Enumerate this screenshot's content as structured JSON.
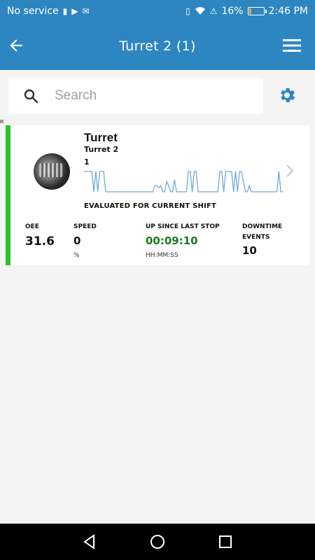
{
  "status_bar": {
    "carrier": "No service",
    "battery_percent": "16%",
    "battery_level": 0.16,
    "time": "2:46 PM",
    "icons": [
      "sim-error-icon",
      "play-store-icon",
      "email-icon",
      "vibrate-icon",
      "wifi-icon",
      "alert-icon",
      "battery-icon"
    ]
  },
  "header": {
    "title": "Turret 2 (1)",
    "icons": {
      "back": "arrow-left-icon",
      "menu": "hamburger-menu-icon"
    }
  },
  "search": {
    "placeholder": "Search",
    "value": "",
    "icons": {
      "search": "search-icon",
      "settings": "gear-icon"
    }
  },
  "machine_card": {
    "title": "Turret",
    "line1": "Turret 2",
    "line2": "1",
    "status_color": "#2fc12f",
    "evaluation_note": "EVALUATED FOR CURRENT SHIFT",
    "metrics": {
      "oee": {
        "label": "OEE",
        "value": "31.6"
      },
      "speed": {
        "label": "SPEED",
        "value": "0",
        "unit": "%"
      },
      "uptime": {
        "label": "UP SINCE LAST STOP",
        "value": "00:09:10",
        "unit": "HH:MM:SS",
        "color": "#1c7a1c"
      },
      "downtime": {
        "label_line1": "DOWNTIME",
        "label_line2": "EVENTS",
        "value": "10"
      }
    }
  },
  "chart_data": {
    "type": "line",
    "series": [
      {
        "values": [
          1,
          1,
          1,
          1,
          1,
          0,
          1,
          0,
          1,
          1,
          1,
          0,
          0,
          0,
          0,
          0,
          0,
          0,
          0,
          0,
          0,
          0,
          0,
          0,
          0,
          0,
          0,
          0,
          0,
          0,
          0,
          0,
          0,
          0,
          0,
          0,
          0.3,
          0.3,
          0.2,
          0.3,
          0,
          0,
          0.5,
          0.3,
          0,
          0,
          0.6,
          0,
          0,
          0,
          0,
          0,
          0,
          1,
          1,
          0,
          1,
          1,
          0,
          0,
          0,
          0,
          0,
          0,
          0,
          0,
          0,
          0,
          0,
          1,
          1,
          0,
          1,
          1,
          1,
          1,
          0,
          1,
          0,
          1,
          1,
          0.5,
          0,
          0,
          0.3,
          0,
          0,
          0,
          0,
          0,
          0,
          0,
          0,
          0,
          0,
          0,
          0,
          0,
          0,
          1,
          0,
          0
        ],
        "color": "#6fa8dc"
      }
    ]
  },
  "nav_bar": {
    "icons": {
      "back": "triangle-back-icon",
      "home": "circle-home-icon",
      "recents": "square-recents-icon"
    }
  }
}
